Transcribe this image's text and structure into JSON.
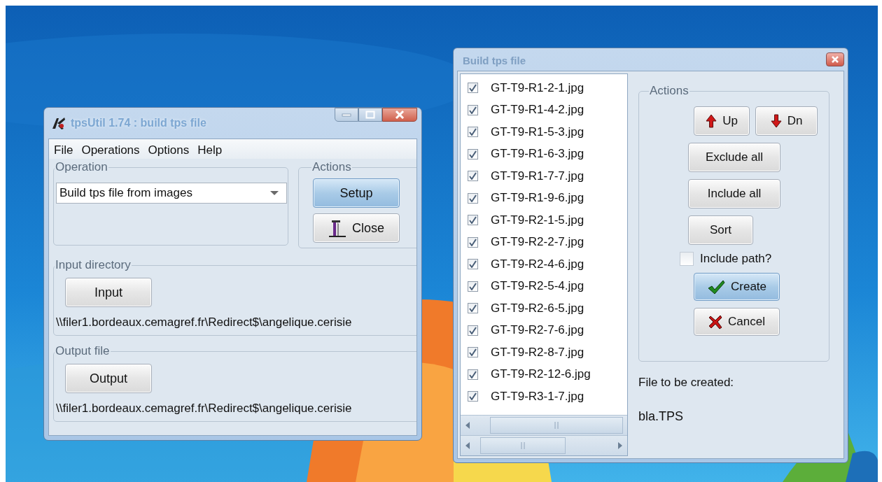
{
  "main_window": {
    "title": "tpsUtil 1.74 : build tps file",
    "menu": [
      "File",
      "Operations",
      "Options",
      "Help"
    ],
    "operation": {
      "label": "Operation",
      "value": "Build tps file from images"
    },
    "actions": {
      "label": "Actions",
      "buttons": [
        {
          "label": "Setup",
          "kind": "plain",
          "focused": true
        },
        {
          "label": "Close",
          "kind": "exit",
          "focused": false
        }
      ]
    },
    "input": {
      "label": "Input directory",
      "button": "Input",
      "path": "\\\\filer1.bordeaux.cemagref.fr\\Redirect$\\angelique.cerisie"
    },
    "output": {
      "label": "Output file",
      "button": "Output",
      "path": "\\\\filer1.bordeaux.cemagref.fr\\Redirect$\\angelique.cerisie"
    }
  },
  "dialog": {
    "title": "Build tps file",
    "files": [
      {
        "name": "GT-T9-R1-2-1.jpg",
        "checked": true
      },
      {
        "name": "GT-T9-R1-4-2.jpg",
        "checked": true
      },
      {
        "name": "GT-T9-R1-5-3.jpg",
        "checked": true
      },
      {
        "name": "GT-T9-R1-6-3.jpg",
        "checked": true
      },
      {
        "name": "GT-T9-R1-7-7.jpg",
        "checked": true
      },
      {
        "name": "GT-T9-R1-9-6.jpg",
        "checked": true
      },
      {
        "name": "GT-T9-R2-1-5.jpg",
        "checked": true
      },
      {
        "name": "GT-T9-R2-2-7.jpg",
        "checked": true
      },
      {
        "name": "GT-T9-R2-4-6.jpg",
        "checked": true
      },
      {
        "name": "GT-T9-R2-5-4.jpg",
        "checked": true
      },
      {
        "name": "GT-T9-R2-6-5.jpg",
        "checked": true
      },
      {
        "name": "GT-T9-R2-7-6.jpg",
        "checked": true
      },
      {
        "name": "GT-T9-R2-8-7.jpg",
        "checked": true
      },
      {
        "name": "GT-T9-R2-12-6.jpg",
        "checked": true
      },
      {
        "name": "GT-T9-R3-1-7.jpg",
        "checked": true
      }
    ],
    "actions_label": "Actions",
    "buttons": [
      {
        "label": "Up",
        "kind": "up",
        "focused": false
      },
      {
        "label": "Dn",
        "kind": "down",
        "focused": false
      },
      {
        "label": "Exclude all",
        "kind": "plain",
        "focused": false
      },
      {
        "label": "Include all",
        "kind": "plain",
        "focused": false
      },
      {
        "label": "Sort",
        "kind": "plain",
        "focused": false
      }
    ],
    "include_path": {
      "label": "Include path?",
      "checked": false
    },
    "commands": [
      {
        "label": "Create",
        "kind": "create",
        "focused": true
      },
      {
        "label": "Cancel",
        "kind": "cancel",
        "focused": false
      }
    ],
    "file_label": "File to be created:",
    "file_name": "bla.TPS"
  }
}
